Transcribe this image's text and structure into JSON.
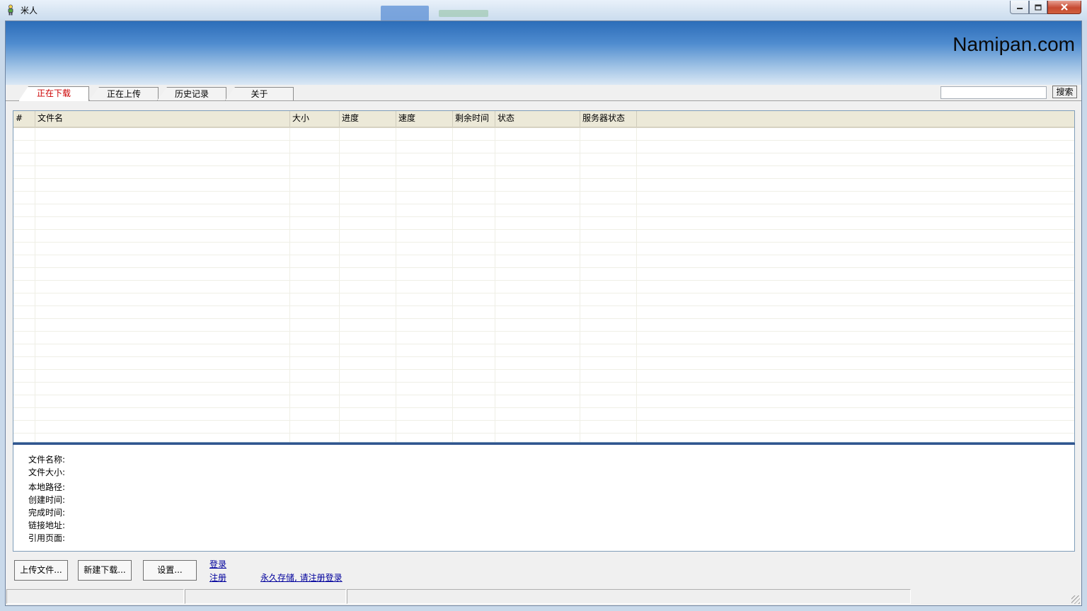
{
  "window": {
    "title": "米人",
    "brand": "Namipan.com"
  },
  "tabs": [
    {
      "label": "正在下载",
      "active": true
    },
    {
      "label": "正在上传",
      "active": false
    },
    {
      "label": "历史记录",
      "active": false
    },
    {
      "label": "关于",
      "active": false
    }
  ],
  "search": {
    "value": "",
    "button_label": "搜索"
  },
  "list": {
    "columns": [
      "#",
      "文件名",
      "大小",
      "进度",
      "速度",
      "剩余时间",
      "状态",
      "服务器状态"
    ],
    "rows": []
  },
  "details": {
    "labels": [
      "文件名称:",
      "文件大小:",
      "本地路径:",
      "创建时间:",
      "完成时间:",
      "链接地址:",
      "引用页面:"
    ]
  },
  "buttons": {
    "upload": "上传文件...",
    "new_download": "新建下载...",
    "settings": "设置..."
  },
  "links": {
    "login": "登录",
    "register": "注册",
    "promo": "永久存储, 请注册登录"
  },
  "colors": {
    "active_tab_text": "#cc0000",
    "banner_top": "#2c6db9",
    "link": "#00009c",
    "splitter": "#30558f"
  }
}
